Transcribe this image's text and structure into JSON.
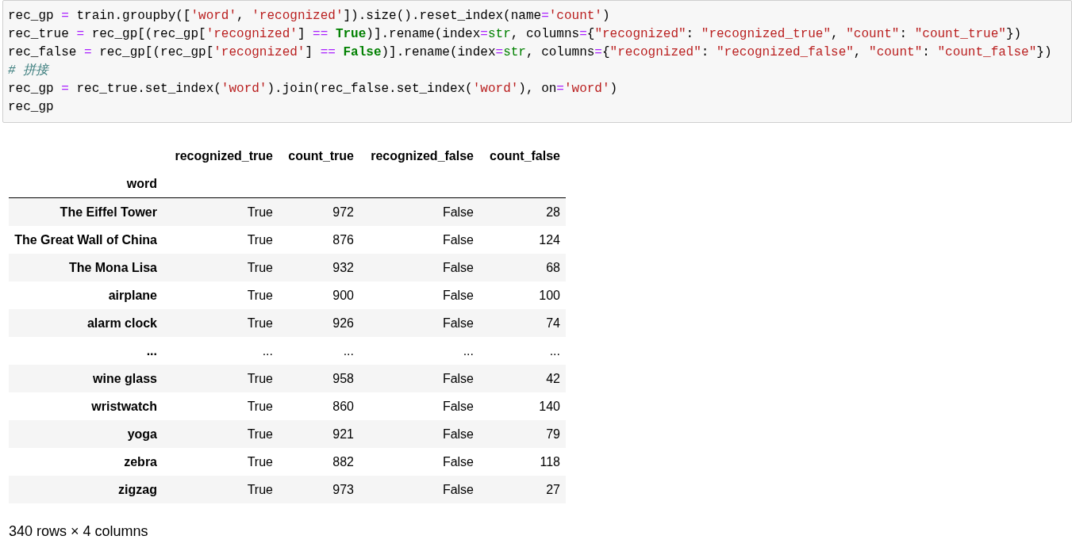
{
  "code_cell": {
    "lines": [
      [
        {
          "kind": "plain",
          "text": "rec_gp "
        },
        {
          "kind": "op",
          "text": "="
        },
        {
          "kind": "plain",
          "text": " train.groupby(["
        },
        {
          "kind": "str",
          "text": "'word'"
        },
        {
          "kind": "plain",
          "text": ", "
        },
        {
          "kind": "str",
          "text": "'recognized'"
        },
        {
          "kind": "plain",
          "text": "]).size().reset_index(name"
        },
        {
          "kind": "op",
          "text": "="
        },
        {
          "kind": "str",
          "text": "'count'"
        },
        {
          "kind": "plain",
          "text": ")"
        }
      ],
      [
        {
          "kind": "plain",
          "text": "rec_true "
        },
        {
          "kind": "op",
          "text": "="
        },
        {
          "kind": "plain",
          "text": " rec_gp[(rec_gp["
        },
        {
          "kind": "str",
          "text": "'recognized'"
        },
        {
          "kind": "plain",
          "text": "] "
        },
        {
          "kind": "op",
          "text": "=="
        },
        {
          "kind": "kw",
          "text": " True"
        },
        {
          "kind": "plain",
          "text": ")].rename(index"
        },
        {
          "kind": "op",
          "text": "="
        },
        {
          "kind": "builtin",
          "text": "str"
        },
        {
          "kind": "plain",
          "text": ", columns"
        },
        {
          "kind": "op",
          "text": "="
        },
        {
          "kind": "plain",
          "text": "{"
        },
        {
          "kind": "str",
          "text": "\"recognized\""
        },
        {
          "kind": "plain",
          "text": ": "
        },
        {
          "kind": "str",
          "text": "\"recognized_true\""
        },
        {
          "kind": "plain",
          "text": ", "
        },
        {
          "kind": "str",
          "text": "\"count\""
        },
        {
          "kind": "plain",
          "text": ": "
        },
        {
          "kind": "str",
          "text": "\"count_true\""
        },
        {
          "kind": "plain",
          "text": "})"
        }
      ],
      [
        {
          "kind": "plain",
          "text": "rec_false "
        },
        {
          "kind": "op",
          "text": "="
        },
        {
          "kind": "plain",
          "text": " rec_gp[(rec_gp["
        },
        {
          "kind": "str",
          "text": "'recognized'"
        },
        {
          "kind": "plain",
          "text": "] "
        },
        {
          "kind": "op",
          "text": "=="
        },
        {
          "kind": "kw",
          "text": " False"
        },
        {
          "kind": "plain",
          "text": ")].rename(index"
        },
        {
          "kind": "op",
          "text": "="
        },
        {
          "kind": "builtin",
          "text": "str"
        },
        {
          "kind": "plain",
          "text": ", columns"
        },
        {
          "kind": "op",
          "text": "="
        },
        {
          "kind": "plain",
          "text": "{"
        },
        {
          "kind": "str",
          "text": "\"recognized\""
        },
        {
          "kind": "plain",
          "text": ": "
        },
        {
          "kind": "str",
          "text": "\"recognized_false\""
        },
        {
          "kind": "plain",
          "text": ", "
        },
        {
          "kind": "str",
          "text": "\"count\""
        },
        {
          "kind": "plain",
          "text": ": "
        },
        {
          "kind": "str",
          "text": "\"count_false\""
        },
        {
          "kind": "plain",
          "text": "})"
        }
      ],
      [
        {
          "kind": "comment",
          "text": "# 拼接"
        }
      ],
      [
        {
          "kind": "plain",
          "text": "rec_gp "
        },
        {
          "kind": "op",
          "text": "="
        },
        {
          "kind": "plain",
          "text": " rec_true.set_index("
        },
        {
          "kind": "str",
          "text": "'word'"
        },
        {
          "kind": "plain",
          "text": ").join(rec_false.set_index("
        },
        {
          "kind": "str",
          "text": "'word'"
        },
        {
          "kind": "plain",
          "text": "), on"
        },
        {
          "kind": "op",
          "text": "="
        },
        {
          "kind": "str",
          "text": "'word'"
        },
        {
          "kind": "plain",
          "text": ")"
        }
      ],
      [
        {
          "kind": "plain",
          "text": "rec_gp"
        }
      ]
    ]
  },
  "table": {
    "columns": [
      "recognized_true",
      "count_true",
      "recognized_false",
      "count_false"
    ],
    "index_name": "word",
    "rows": [
      {
        "index": "The Eiffel Tower",
        "cells": [
          "True",
          "972",
          "False",
          "28"
        ]
      },
      {
        "index": "The Great Wall of China",
        "cells": [
          "True",
          "876",
          "False",
          "124"
        ]
      },
      {
        "index": "The Mona Lisa",
        "cells": [
          "True",
          "932",
          "False",
          "68"
        ]
      },
      {
        "index": "airplane",
        "cells": [
          "True",
          "900",
          "False",
          "100"
        ]
      },
      {
        "index": "alarm clock",
        "cells": [
          "True",
          "926",
          "False",
          "74"
        ]
      },
      {
        "index": "...",
        "cells": [
          "...",
          "...",
          "...",
          "..."
        ]
      },
      {
        "index": "wine glass",
        "cells": [
          "True",
          "958",
          "False",
          "42"
        ]
      },
      {
        "index": "wristwatch",
        "cells": [
          "True",
          "860",
          "False",
          "140"
        ]
      },
      {
        "index": "yoga",
        "cells": [
          "True",
          "921",
          "False",
          "79"
        ]
      },
      {
        "index": "zebra",
        "cells": [
          "True",
          "882",
          "False",
          "118"
        ]
      },
      {
        "index": "zigzag",
        "cells": [
          "True",
          "973",
          "False",
          "27"
        ]
      }
    ]
  },
  "footer": "340 rows × 4 columns"
}
